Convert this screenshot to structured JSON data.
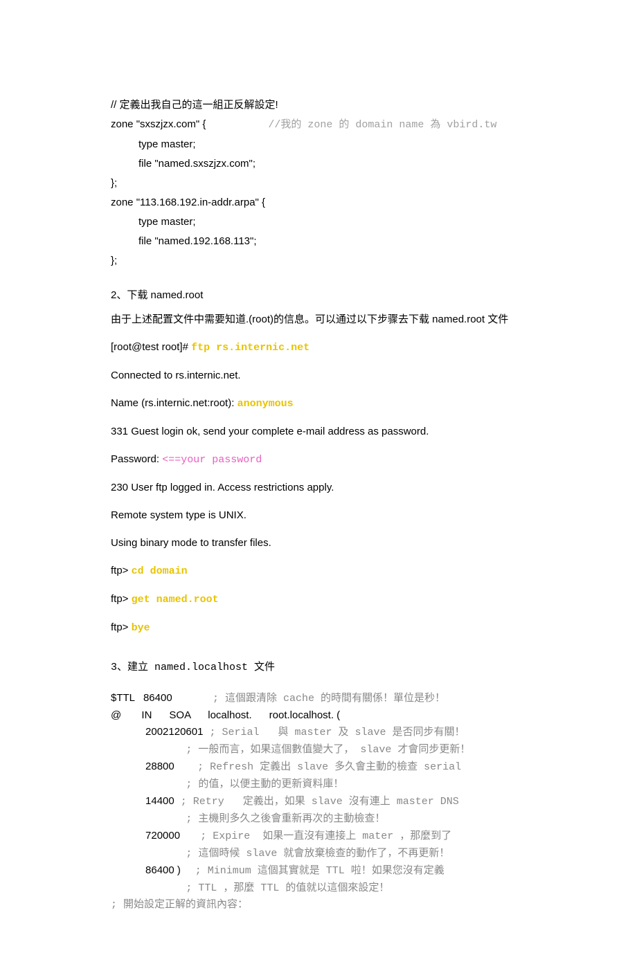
{
  "block1": {
    "l1": "// 定義出我自己的這一組正反解設定!",
    "l2a": "zone \"sxszjzx.com\" {",
    "l2b": "          //我的 zone 的 domain name 為 vbird.tw",
    "l3": "type master;",
    "l4": "file \"named.sxszjzx.com\";",
    "l5": "};",
    "l6": "zone \"113.168.192.in-addr.arpa\" {",
    "l7": "type master;",
    "l8": "file \"named.192.168.113\";",
    "l9": "};"
  },
  "sec2": {
    "title": "2、下载 named.root",
    "p1": "由于上述配置文件中需要知道.(root)的信息。可以通过以下步骤去下载 named.root 文件",
    "p2a": "[root@test root]# ",
    "p2b": "ftp rs.internic.net",
    "p3": "Connected to rs.internic.net.",
    "p4a": "Name (rs.internic.net:root): ",
    "p4b": "anonymous",
    "p5": "331 Guest login ok, send your complete e-mail address as password.",
    "p6a": "Password: ",
    "p6b": "<==your password",
    "p7": "230 User ftp logged in.  Access restrictions apply.",
    "p8": "Remote system type is UNIX.",
    "p9": "Using binary mode to transfer files.",
    "p10a": "ftp> ",
    "p10b": "cd domain",
    "p11a": "ftp> ",
    "p11b": "get named.root",
    "p12a": "ftp> ",
    "p12b": "bye"
  },
  "sec3": {
    "title": "3、建立 named.localhost 文件",
    "l1a": "$TTL   86400",
    "l1b": "; 這個跟清除 cache 的時間有關係！單位是秒！",
    "l2": "@       IN      SOA      localhost.      root.localhost. (",
    "l3a": "2002120601",
    "l3b": " ; Serial   與 master 及 slave 是否同步有關！",
    "l3c": "; 一般而言，如果這個數值變大了， slave 才會同步更新！",
    "l4a": "28800",
    "l4b": "; Refresh 定義出 slave 多久會主動的檢查 serial",
    "l4c": "; 的值，以便主動的更新資料庫！",
    "l5a": "14400",
    "l5b": " ; Retry   定義出，如果 slave 沒有連上 master DNS",
    "l5c": "; 主機則多久之後會重新再次的主動檢查！",
    "l6a": "720000",
    "l6b": "; Expire  如果一直沒有連接上 mater ，那麼到了",
    "l6c": "; 這個時候 slave 就會放棄檢查的動作了，不再更新！",
    "l7a": "86400 )",
    "l7b": "; Minimum 這個其實就是 TTL 啦！如果您沒有定義",
    "l7c": "; TTL ，那麼 TTL 的值就以這個來設定！",
    "l8": "; 開始設定正解的資訊內容："
  }
}
